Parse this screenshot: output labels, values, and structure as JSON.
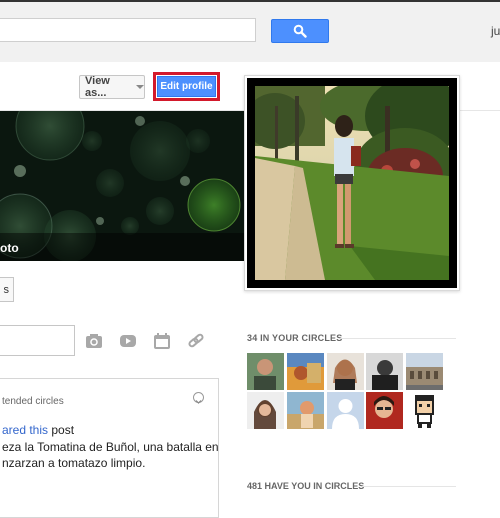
{
  "header": {
    "search_placeholder": "",
    "user_label": "ju"
  },
  "profile_bar": {
    "view_as_label": "View as...",
    "edit_profile_label": "Edit profile"
  },
  "cover": {
    "label": "oto"
  },
  "small_button_label": "s",
  "share_icons": [
    "camera-icon",
    "video-icon",
    "event-icon",
    "link-icon"
  ],
  "post": {
    "visibility_text": "tended circles",
    "shared_prefix": "ared this",
    "shared_object": "post",
    "lines": [
      "eza la Tomatina de Buñol, una batalla en",
      "nzarzan a tomatazo limpio."
    ]
  },
  "circles": {
    "in_your_circles_label": "34 IN YOUR CIRCLES",
    "have_you_label": "481 HAVE YOU IN CIRCLES"
  },
  "colors": {
    "accent_blue": "#4d90fe",
    "highlight_red": "#d3192b"
  }
}
